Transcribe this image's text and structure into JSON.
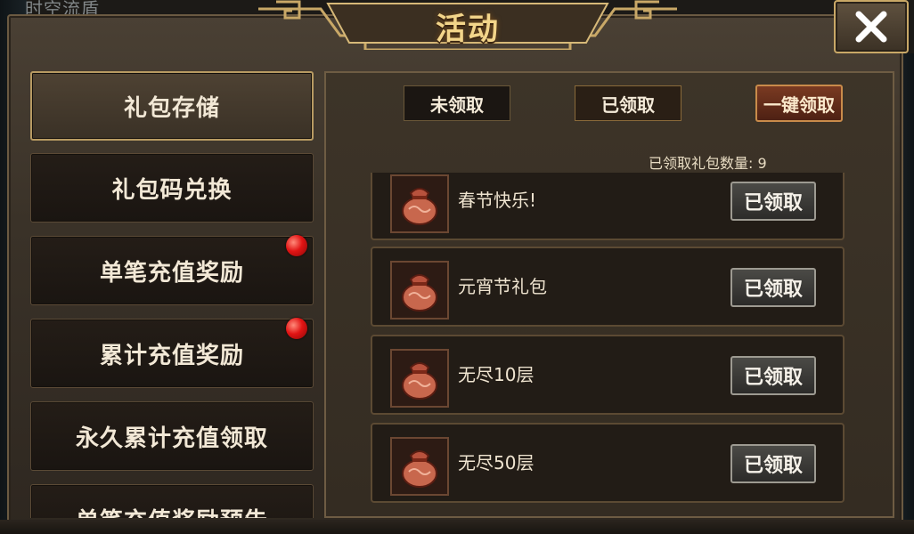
{
  "background": {
    "top_text": "时空流盾"
  },
  "window": {
    "title": "活动",
    "close_label": "✕"
  },
  "sidebar": {
    "items": [
      {
        "label": "礼包存储",
        "active": true,
        "badge": false
      },
      {
        "label": "礼包码兑换",
        "active": false,
        "badge": false
      },
      {
        "label": "单笔充值奖励",
        "active": false,
        "badge": true
      },
      {
        "label": "累计充值奖励",
        "active": false,
        "badge": true
      },
      {
        "label": "永久累计充值领取",
        "active": false,
        "badge": false
      },
      {
        "label": "单笔充值奖励预告",
        "active": false,
        "badge": false
      }
    ]
  },
  "filters": {
    "unclaimed": "未领取",
    "claimed": "已领取",
    "claim_all": "一键领取"
  },
  "count_text": "已领取礼包数量: 9",
  "gifts": [
    {
      "name": "春节快乐!",
      "button": "已领取",
      "icon": "gift-bag-icon"
    },
    {
      "name": "元宵节礼包",
      "button": "已领取",
      "icon": "gift-bag-icon"
    },
    {
      "name": "无尽10层",
      "button": "已领取",
      "icon": "gift-bag-icon"
    },
    {
      "name": "无尽50层",
      "button": "已领取",
      "icon": "gift-bag-icon"
    }
  ],
  "colors": {
    "accent_gold": "#f3d58a",
    "badge_red": "#e11414",
    "panel_border": "#6e5c43"
  }
}
